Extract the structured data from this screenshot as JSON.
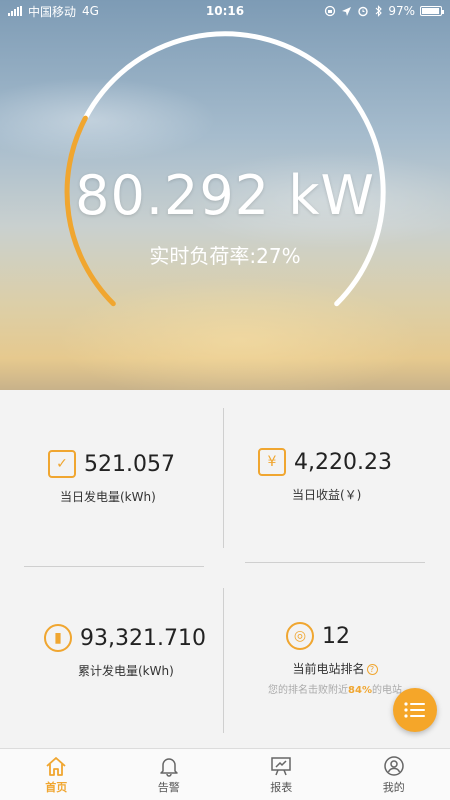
{
  "status_bar": {
    "carrier": "中国移动",
    "network": "4G",
    "time": "10:16",
    "battery": "97%",
    "battery_level": 0.97
  },
  "gauge": {
    "power": "80.292 kW",
    "load_rate_text": "实时负荷率:27%",
    "load_rate": 0.27
  },
  "stats": {
    "daily_generation": {
      "value": "521.057",
      "label": "当日发电量(kWh)"
    },
    "daily_income": {
      "value": "4,220.23",
      "label": "当日收益(￥)"
    },
    "total_generation": {
      "value": "93,321.710",
      "label": "累计发电量(kWh)"
    },
    "station_rank": {
      "value": "12",
      "label": "当前电站排名",
      "sub_prefix": "您的排名击败附近",
      "sub_percent": "84%",
      "sub_suffix": "的电站"
    }
  },
  "tabs": [
    {
      "label": "首页",
      "icon": "home-icon",
      "active": true
    },
    {
      "label": "告警",
      "icon": "bell-icon",
      "active": false
    },
    {
      "label": "报表",
      "icon": "report-icon",
      "active": false
    },
    {
      "label": "我的",
      "icon": "user-icon",
      "active": false
    }
  ],
  "colors": {
    "accent": "#f0a630",
    "arc": "#ffffff"
  }
}
